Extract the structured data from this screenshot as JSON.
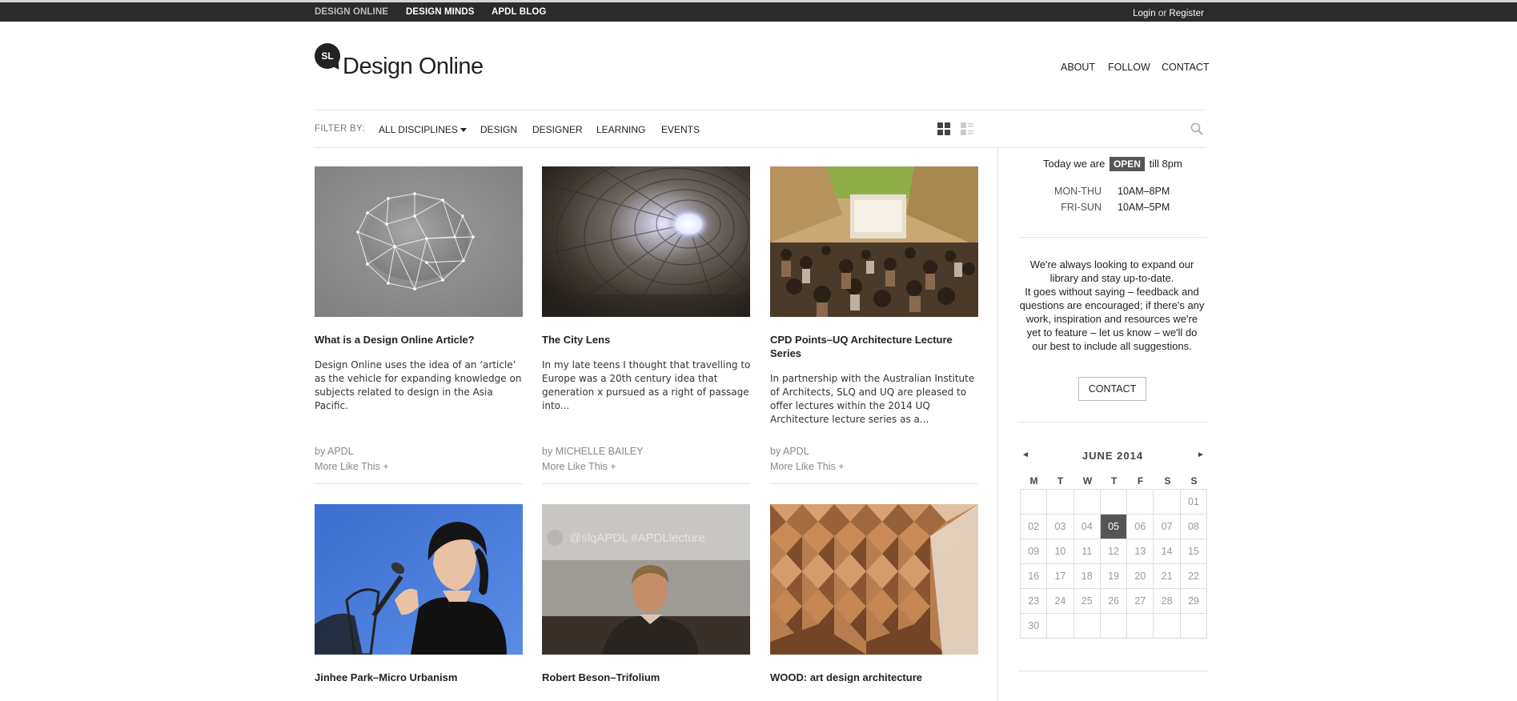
{
  "topbar": {
    "links": [
      "DESIGN ONLINE",
      "DESIGN MINDS",
      "APDL BLOG"
    ],
    "login": "Login",
    "or": "or",
    "register": "Register"
  },
  "header": {
    "logo_badge": "SL",
    "site_title": "Design Online",
    "nav": [
      "ABOUT",
      "FOLLOW",
      "CONTACT"
    ]
  },
  "filter": {
    "label": "FILTER BY:",
    "items": [
      "ALL DISCIPLINES",
      "DESIGN",
      "DESIGNER",
      "LEARNING",
      "EVENTS"
    ]
  },
  "cards": [
    {
      "title": "What is a Design Online Article?",
      "desc": "Design Online uses the idea of an ‘article’ as the vehicle for expanding knowledge on subjects related to design in the Asia Pacific.",
      "by_prefix": "by",
      "author": "APDL",
      "more": "More Like This +"
    },
    {
      "title": "The City Lens",
      "desc": "In my late teens I thought that travelling to Europe was a 20th century idea that generation x pursued as a right of passage into...",
      "by_prefix": "by",
      "author": "MICHELLE BAILEY",
      "more": "More Like This +"
    },
    {
      "title": "CPD Points–UQ Architecture Lecture Series",
      "desc": "In partnership with the Australian Institute of Architects, SLQ and UQ are pleased to offer lectures within the 2014 UQ Architecture lecture series as a...",
      "by_prefix": "by",
      "author": "APDL",
      "more": "More Like This +"
    },
    {
      "title": "Jinhee Park–Micro Urbanism"
    },
    {
      "title": "Robert Beson–Trifolium",
      "image_overlay": "@slqAPDL  #APDLlecture"
    },
    {
      "title": "WOOD: art design architecture"
    }
  ],
  "sidebar": {
    "today_prefix": "Today we are",
    "status": "OPEN",
    "today_suffix": "till 8pm",
    "hours": [
      {
        "days": "MON-THU",
        "time": "10AM–8PM"
      },
      {
        "days": "FRI-SUN",
        "time": "10AM–5PM"
      }
    ],
    "library_text": "We're always looking to expand our library and stay up-to-date.",
    "feedback_text": "It goes without saying – feedback and questions are encouraged; if there's any work, inspiration and resources we're yet to feature – let us know – we'll do our best to include all suggestions.",
    "contact_button": "CONTACT"
  },
  "calendar": {
    "prev": "◄",
    "next": "►",
    "month": "JUNE 2014",
    "weekdays": [
      "M",
      "T",
      "W",
      "T",
      "F",
      "S",
      "S"
    ],
    "weeks": [
      [
        "",
        "",
        "",
        "",
        "",
        "",
        "01"
      ],
      [
        "02",
        "03",
        "04",
        "05",
        "06",
        "07",
        "08"
      ],
      [
        "09",
        "10",
        "11",
        "12",
        "13",
        "14",
        "15"
      ],
      [
        "16",
        "17",
        "18",
        "19",
        "20",
        "21",
        "22"
      ],
      [
        "23",
        "24",
        "25",
        "26",
        "27",
        "28",
        "29"
      ],
      [
        "30",
        "",
        "",
        "",
        "",
        "",
        ""
      ]
    ],
    "today": "05"
  },
  "colors": {
    "topbar_bg": "#2b2b2b",
    "badge_bg": "#555555",
    "text": "#222222",
    "muted": "#888888"
  }
}
